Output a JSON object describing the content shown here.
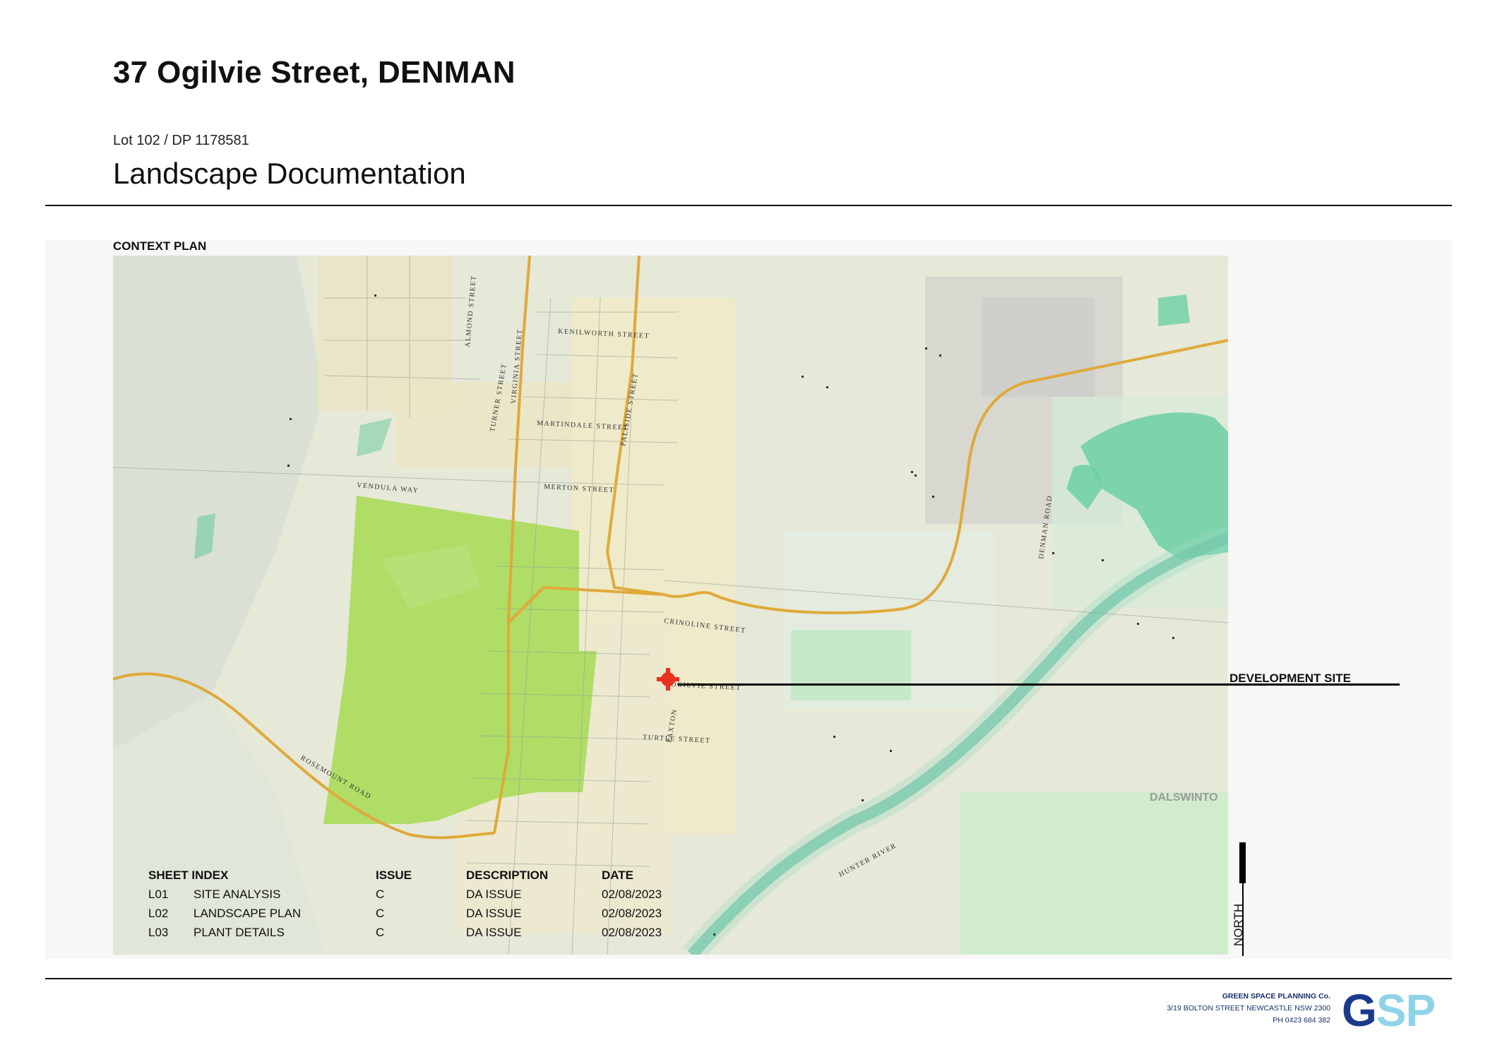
{
  "header": {
    "title": "37 Ogilvie Street, DENMAN",
    "lot": "Lot 102 / DP 1178581",
    "subtitle": "Landscape Documentation"
  },
  "context": {
    "label": "CONTEXT PLAN",
    "development_site_label": "DEVELOPMENT SITE",
    "north_label": "NORTH",
    "map_labels": {
      "almond": "ALMOND STREET",
      "kenilworth": "KENILWORTH STREET",
      "martindale": "MARTINDALE STREET",
      "paliside": "PALISIDE STREET",
      "turner": "TURNER STREET",
      "virginia": "VIRGINIA STREET",
      "vendula": "VENDULA WAY",
      "merton": "MERTON STREET",
      "crinoline": "CRINOLINE STREET",
      "ogilvie": "OGILVIE STREET",
      "denman_road": "DENMAN ROAD",
      "rosemount": "ROSEMOUNT ROAD",
      "turtle": "TURTLE STREET",
      "paxton": "PAXTON",
      "hunter": "HUNTER RIVER",
      "dalswinton": "DALSWINTO"
    }
  },
  "sheet_index": {
    "headers": {
      "sheet": "SHEET INDEX",
      "issue": "ISSUE",
      "description": "DESCRIPTION",
      "date": "DATE"
    },
    "rows": [
      {
        "code": "L01",
        "name": "SITE ANALYSIS",
        "issue": "C",
        "description": "DA ISSUE",
        "date": "02/08/2023"
      },
      {
        "code": "L02",
        "name": "LANDSCAPE PLAN",
        "issue": "C",
        "description": "DA ISSUE",
        "date": "02/08/2023"
      },
      {
        "code": "L03",
        "name": "PLANT DETAILS",
        "issue": "C",
        "description": "DA ISSUE",
        "date": "02/08/2023"
      }
    ]
  },
  "company": {
    "name": "GREEN SPACE PLANNING Co.",
    "address": "3/19 BOLTON STREET NEWCASTLE NSW 2300",
    "phone": "PH 0423 684 382",
    "logo_g": "G",
    "logo_sp": "SP"
  },
  "colors": {
    "site_marker": "#e8321e",
    "logo_dark": "#1b3a8c",
    "logo_light": "#8fd3e8",
    "park_green": "#a8db5a",
    "river": "#5fbfa0",
    "main_road": "#e0a93a"
  }
}
